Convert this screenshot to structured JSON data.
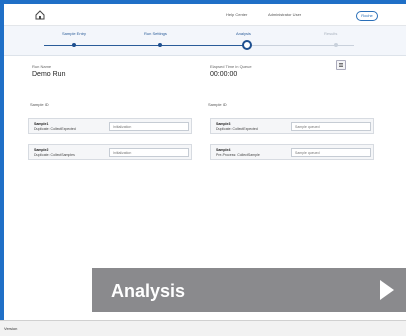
{
  "topbar": {
    "links": [
      "Help Center",
      "Administrator User"
    ],
    "logo": "Roche"
  },
  "stepper": {
    "steps": [
      {
        "label": "Sample Entry",
        "state": "done"
      },
      {
        "label": "Run Settings",
        "state": "done"
      },
      {
        "label": "Analysis",
        "state": "current"
      },
      {
        "label": "Results",
        "state": "upcoming"
      }
    ]
  },
  "run": {
    "name_label": "Run Name",
    "name_value": "Demo Run",
    "elapsed_label": "Elapsed Time in Queue",
    "elapsed_value": "00:00:00"
  },
  "groups": [
    {
      "title": "Sample ID",
      "cards": [
        {
          "line1": "Sample1",
          "line2": "Duplicate: CollectExpected",
          "status": "Initialization"
        },
        {
          "line1": "Sample2",
          "line2": "Duplicate: CollectSamples",
          "status": "Initialization"
        }
      ]
    },
    {
      "title": "Sample ID",
      "cards": [
        {
          "line1": "Sample3",
          "line2": "Duplicate: CollectExpected",
          "status": "Sample queued"
        },
        {
          "line1": "Sample4",
          "line2": "Pre-Process: CollectSample",
          "status": "Sample queued"
        }
      ]
    }
  ],
  "banner": {
    "label": "Analysis"
  },
  "bottombar": {
    "tag": "Version"
  },
  "colors": {
    "accent": "#1d4f8f",
    "banner_bg": "#8a8a8d",
    "frame_blue": "#1f6fc7"
  }
}
